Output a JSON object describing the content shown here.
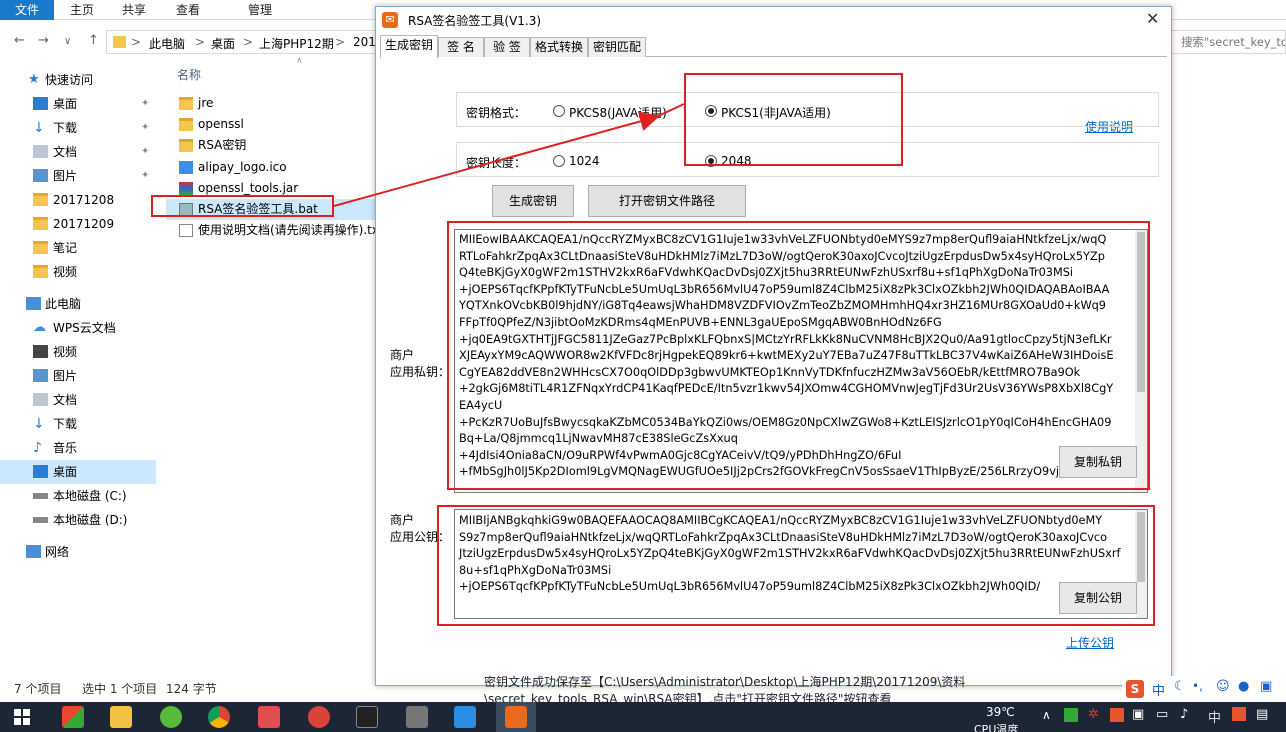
{
  "explorer": {
    "ribbon_tabs": [
      "文件",
      "主页",
      "共享",
      "查看",
      "管理"
    ],
    "breadcrumb": [
      "此电脑",
      "桌面",
      "上海PHP12期",
      "2017"
    ],
    "search_placeholder": "搜索\"secret_key_tools_",
    "nav": {
      "quick_access": "快速访问",
      "items": [
        "桌面",
        "下载",
        "文档",
        "图片",
        "20171208",
        "20171209",
        "笔记",
        "视频"
      ],
      "this_pc": "此电脑",
      "pc_items": [
        "WPS云文档",
        "视频",
        "图片",
        "文档",
        "下载",
        "音乐",
        "桌面",
        "本地磁盘 (C:)",
        "本地磁盘 (D:)"
      ],
      "network": "网络"
    },
    "column_header": "名称",
    "files": [
      "jre",
      "openssl",
      "RSA密钥",
      "alipay_logo.ico",
      "openssl_tools.jar",
      "RSA签名验签工具.bat",
      "使用说明文档(请先阅读再操作).txt"
    ],
    "status": {
      "count": "7 个项目",
      "selected": "选中 1 个项目",
      "size": "124 字节"
    }
  },
  "dialog": {
    "title": "RSA签名验签工具(V1.3)",
    "tabs": [
      "生成密钥",
      "签  名",
      "验  签",
      "格式转换",
      "密钥匹配"
    ],
    "help_link": "使用说明",
    "key_format": {
      "label": "密钥格式：",
      "options": [
        "PKCS8(JAVA适用)",
        "PKCS1(非JAVA适用)"
      ],
      "selected": 1
    },
    "key_length": {
      "label": "密钥长度：",
      "options": [
        "1024",
        "2048"
      ],
      "selected": 1
    },
    "buttons": {
      "generate": "生成密钥",
      "open_path": "打开密钥文件路径",
      "copy_private": "复制私钥",
      "copy_public": "复制公钥"
    },
    "private_key": {
      "label1": "商户",
      "label2": "应用私钥：",
      "lines": [
        "MIIEowIBAAKCAQEA1/nQccRYZMyxBC8zCV1G1Iuje1w33vhVeLZFUONbtyd0eMYS9z7mp8erQufl9aiaHNtkfzeLjx/wqQ",
        "RTLoFahkrZpqAx3CLtDnaasiSteV8uHDkHMlz7iMzL7D3oW/ogtQeroK30axoJCvcoJtziUgzErpdusDw5x4syHQroLx5YZp",
        "Q4teBKjGyX0gWF2m1STHV2kxR6aFVdwhKQacDvDsj0ZXjt5hu3RRtEUNwFzhUSxrf8u+sf1qPhXgDoNaTr03MSi",
        "+jOEPS6TqcfKPpfKTyTFuNcbLe5UmUqL3bR656MvlU47oP59uml8Z4ClbM25iX8zPk3ClxOZkbh2JWh0QIDAQABAoIBAA",
        "YQTXnkOVcbKB0l9hjdNY/iG8Tq4eawsjWhaHDM8VZDFVIOvZmTeoZbZMOMHmhHQ4xr3HZ16MUr8GXOaUd0+kWq9",
        "FFpTf0QPfeZ/N3jibtOoMzKDRms4qMEnPUVB+ENNL3gaUEpoSMgqABW0BnHOdNz6FG",
        "+jq0EA9tGXTHTjJFGC5811JZeGaz7PcBplxKLFQbnxS|MCtzYrRFLkKk8NuCVNM8HcBJX2Qu0/Aa91gtlocCpzy5tjN3efLKr",
        "XJEAyxYM9cAQWWOR8w2KfVFDc8rjHgpekEQ89kr6+kwtMEXy2uY7EBa7uZ47F8uTTkLBC37V4wKaiZ6AHeW3IHDoisE",
        "CgYEA82ddVE8n2WHHcsCX7O0qOlDDp3gbwvUMKTEOp1KnnVyTDKfnfuczHZMw3aV56OEbR/kEttfMRO7Ba9Ok",
        "+2gkGj6M8tiTL4R1ZFNqxYrdCP41KaqfPEDcE/Itn5vzr1kwv54JXOmw4CGHOMVnwJegTjFd3Ur2UsV36YWsP8XbXl8CgY",
        "EA4ycU",
        "+PcKzR7UoBuJfsBwycsqkaKZbMC0534BaYkQZi0ws/OEM8Gz0NpCXlwZGWo8+KztLEISJzrlcO1pY0qICoH4hEncGHA09",
        "Bq+La/Q8jmmcq1LjNwavMH87cE38SleGcZsXxuq",
        "+4JdIsi4Onia8aCN/O9uRPWf4vPwmA0Gjc8CgYACeivV/tQ9/yPDhDhHngZO/6FuI",
        "+fMbSgJh0lJ5Kp2DIoml9LgVMQNagEWUGfUOe5IJj2pCrs2fGOVkFregCnV5osSsaeV1ThIpByzE/256LRrzyO9vj0/KEjU9"
      ]
    },
    "public_key": {
      "label1": "商户",
      "label2": "应用公钥：",
      "lines": [
        "MIIBIjANBgkqhkiG9w0BAQEFAAOCAQ8AMIIBCgKCAQEA1/nQccRYZMyxBC8zCV1G1Iuje1w33vhVeLZFUONbtyd0eMY",
        "S9z7mp8erQufl9aiaHNtkfzeLjx/wqQRTLoFahkrZpqAx3CLtDnaasiSteV8uHDkHMlz7iMzL7D3oW/ogtQeroK30axoJCvco",
        "JtziUgzErpdusDw5x4syHQroLx5YZpQ4teBKjGyX0gWF2m1STHV2kxR6aFVdwhKQacDvDsj0ZXjt5hu3RRtEUNwFzhUSxrf",
        "8u+sf1qPhXgDoNaTr03MSi",
        "+jOEPS6TqcfKPpfKTyTFuNcbLe5UmUqL3bR656MvlU47oP59uml8Z4ClbM25iX8zPk3ClxOZkbh2JWh0QID/"
      ]
    },
    "save_message1": "密钥文件成功保存至【C:\\Users\\Administrator\\Desktop\\上海PHP12期\\20171209\\资料",
    "save_message2": "\\secret_key_tools_RSA_win\\RSA密钥】,点击\"打开密钥文件路径\"按钮查看",
    "upload_link": "上传公钥"
  },
  "taskbar": {
    "temperature": "39℃",
    "cpu_label": "CPU温度",
    "ime_lang": "中"
  },
  "ime_bar": {
    "lang": "中",
    "punct": "•,"
  },
  "colors": {
    "accent": "#1979ca",
    "annotation_red": "#e02020",
    "link": "#0066cc"
  }
}
